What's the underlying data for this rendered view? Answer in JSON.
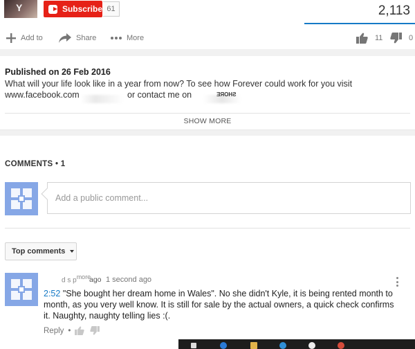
{
  "channel": {
    "thumb_letter": "Y",
    "subscribe_label": "Subscribe",
    "subscriber_count": "61"
  },
  "video": {
    "view_count": "2,113",
    "likes": "11",
    "dislikes": "0"
  },
  "actions": {
    "add_to": "Add to",
    "share": "Share",
    "more": "More"
  },
  "description": {
    "published": "Published on 26 Feb 2016",
    "line1": "What will your life look like in a year from now? To see how Forever could work for you visit",
    "line2_start": "www.facebook.com",
    "line2_mid": "or contact me on",
    "mirrored_text": "SHORE",
    "show_more": "SHOW MORE"
  },
  "comments": {
    "header": "COMMENTS • 1",
    "placeholder": "Add a public comment...",
    "sort_label": "Top comments",
    "items": [
      {
        "author": "d s p",
        "author_suffix": "more",
        "ago": "ago",
        "time": "1 second ago",
        "timestamp": "2:52",
        "text": " \"She bought her dream home in Wales\".  No she didn't Kyle, it is being rented month to month, as you very well know.  It is still for sale by the actual owners, a quick check confirms it.  Naughty, naughty telling lies :(.",
        "reply": "Reply",
        "dot": "•"
      }
    ]
  },
  "colors": {
    "subscribe_red": "#e62117",
    "accent_blue": "#167ac6",
    "avatar_blue": "#86a7e6"
  }
}
